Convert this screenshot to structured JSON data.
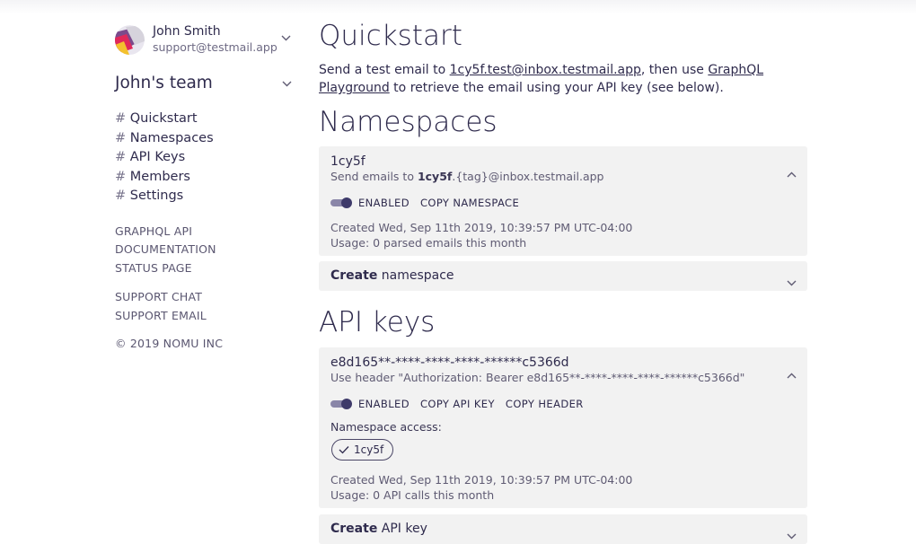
{
  "user": {
    "name": "John Smith",
    "email": "support@testmail.app"
  },
  "team": {
    "name": "John's team"
  },
  "nav": {
    "hash": "#",
    "items": [
      "Quickstart",
      "Namespaces",
      "API Keys",
      "Members",
      "Settings"
    ]
  },
  "links": {
    "group1": [
      "GRAPHQL API",
      "DOCUMENTATION",
      "STATUS PAGE"
    ],
    "group2": [
      "SUPPORT CHAT",
      "SUPPORT EMAIL"
    ],
    "copyright": "© 2019 NOMU INC"
  },
  "quickstart": {
    "title": "Quickstart",
    "text1": "Send a test email to ",
    "email_link": "1cy5f.test@inbox.testmail.app",
    "text2": ", then use ",
    "playground_link": "GraphQL Playground",
    "text3": " to retrieve the email using your API key (see below)."
  },
  "namespaces": {
    "title": "Namespaces",
    "card": {
      "name": "1cy5f",
      "sub_prefix": "Send emails to ",
      "sub_bold": "1cy5f",
      "sub_suffix": ".{tag}@inbox.testmail.app",
      "enabled_label": "ENABLED",
      "copy_label": "COPY NAMESPACE",
      "created": "Created Wed, Sep 11th 2019, 10:39:57 PM UTC-04:00",
      "usage": "Usage: 0 parsed emails this month"
    },
    "create": {
      "bold": "Create",
      "rest": " namespace"
    }
  },
  "api_keys": {
    "title": "API keys",
    "card": {
      "key": "e8d165**-****-****-****-******c5366d",
      "header_text": "Use header \"Authorization: Bearer e8d165**-****-****-****-******c5366d\"",
      "enabled_label": "ENABLED",
      "copy_key_label": "COPY API KEY",
      "copy_header_label": "COPY HEADER",
      "ns_access_label": "Namespace access:",
      "ns_chip": "1cy5f",
      "created": "Created Wed, Sep 11th 2019, 10:39:57 PM UTC-04:00",
      "usage": "Usage: 0 API calls this month"
    },
    "create": {
      "bold": "Create",
      "rest": " API key"
    }
  },
  "colors": {
    "text": "#2f2b4d",
    "card_bg": "#f2f2f2",
    "toggle": "#3e3a6a"
  },
  "icons": [
    "chevron-down-icon",
    "chevron-up-icon",
    "check-icon",
    "avatar-logo"
  ]
}
